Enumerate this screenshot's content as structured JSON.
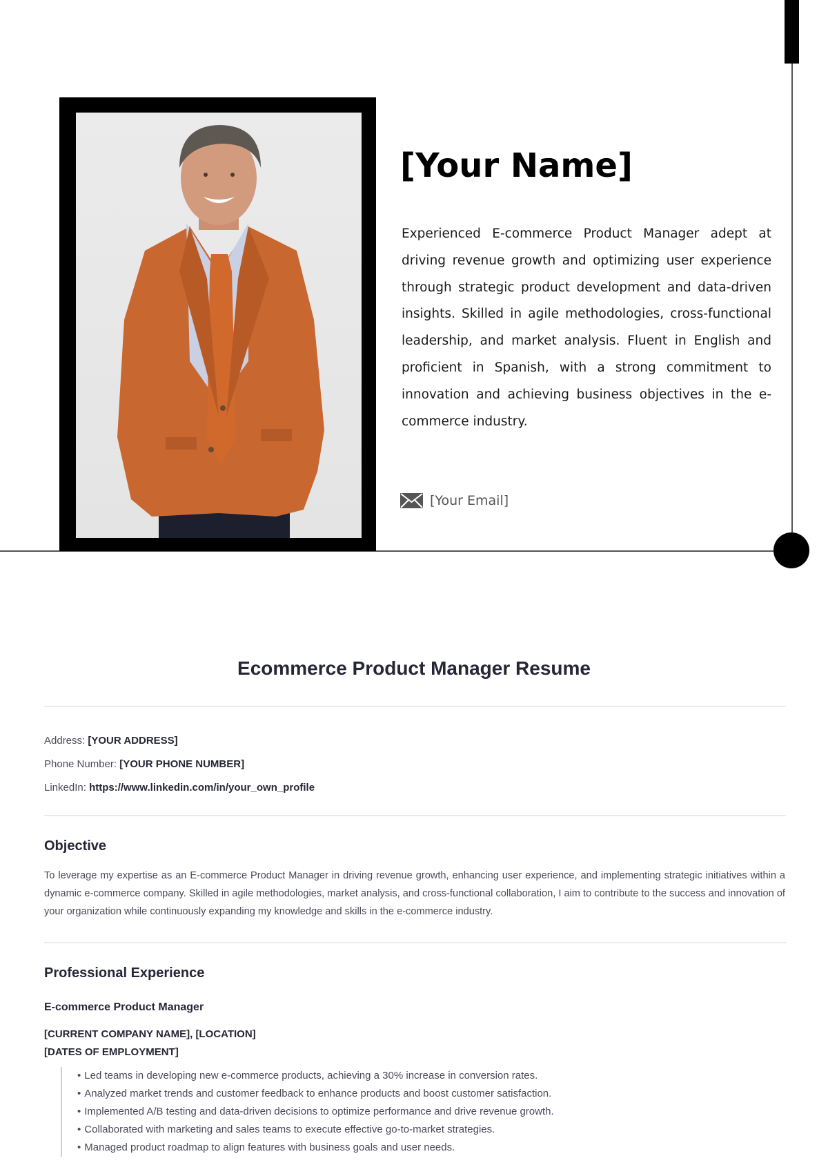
{
  "header": {
    "name": "[Your Name]",
    "summary": "Experienced E-commerce Product Manager adept at driving revenue growth and optimizing user experience through strategic product development and data-driven insights. Skilled in agile methodologies, cross-functional leadership, and market analysis. Fluent in English and proficient in Spanish, with a strong commitment to innovation and achieving business objectives in the e-commerce industry.",
    "email_icon": "envelope-icon",
    "email": "[Your Email]",
    "photo_description": "Portrait of a smiling man with grey hair wearing an orange blazer, light blue shirt and orange tie"
  },
  "document": {
    "title": "Ecommerce Product Manager Resume",
    "contact": [
      {
        "label": "Address:",
        "value": "[YOUR ADDRESS]"
      },
      {
        "label": "Phone Number:",
        "value": "[YOUR PHONE NUMBER]"
      },
      {
        "label": "LinkedIn:",
        "value": "https://www.linkedin.com/in/your_own_profile"
      }
    ],
    "objective": {
      "heading": "Objective",
      "text": "To leverage my expertise as an E-commerce Product Manager in driving revenue growth, enhancing user experience, and implementing strategic initiatives within a dynamic e-commerce company. Skilled in agile methodologies, market analysis, and cross-functional collaboration, I aim to contribute to the success and innovation of your organization while continuously expanding my knowledge and skills in the e-commerce industry."
    },
    "experience": {
      "heading": "Professional Experience",
      "jobs": [
        {
          "title": "E-commerce Product Manager",
          "company": "[CURRENT COMPANY NAME], [LOCATION]",
          "dates": "[DATES OF EMPLOYMENT]",
          "bullets": [
            "Led teams in developing new e-commerce products, achieving a 30% increase in conversion rates.",
            "Analyzed market trends and customer feedback to enhance products and boost customer satisfaction.",
            "Implemented A/B testing and data-driven decisions to optimize performance and drive revenue growth.",
            "Collaborated with marketing and sales teams to execute effective go-to-market strategies.",
            "Managed product roadmap to align features with business goals and user needs."
          ]
        }
      ]
    }
  },
  "colors": {
    "text_dark": "#262637",
    "text_muted": "#4a4a5a",
    "accent_black": "#000000",
    "divider": "#ebebee",
    "blazer": "#c8672f"
  }
}
